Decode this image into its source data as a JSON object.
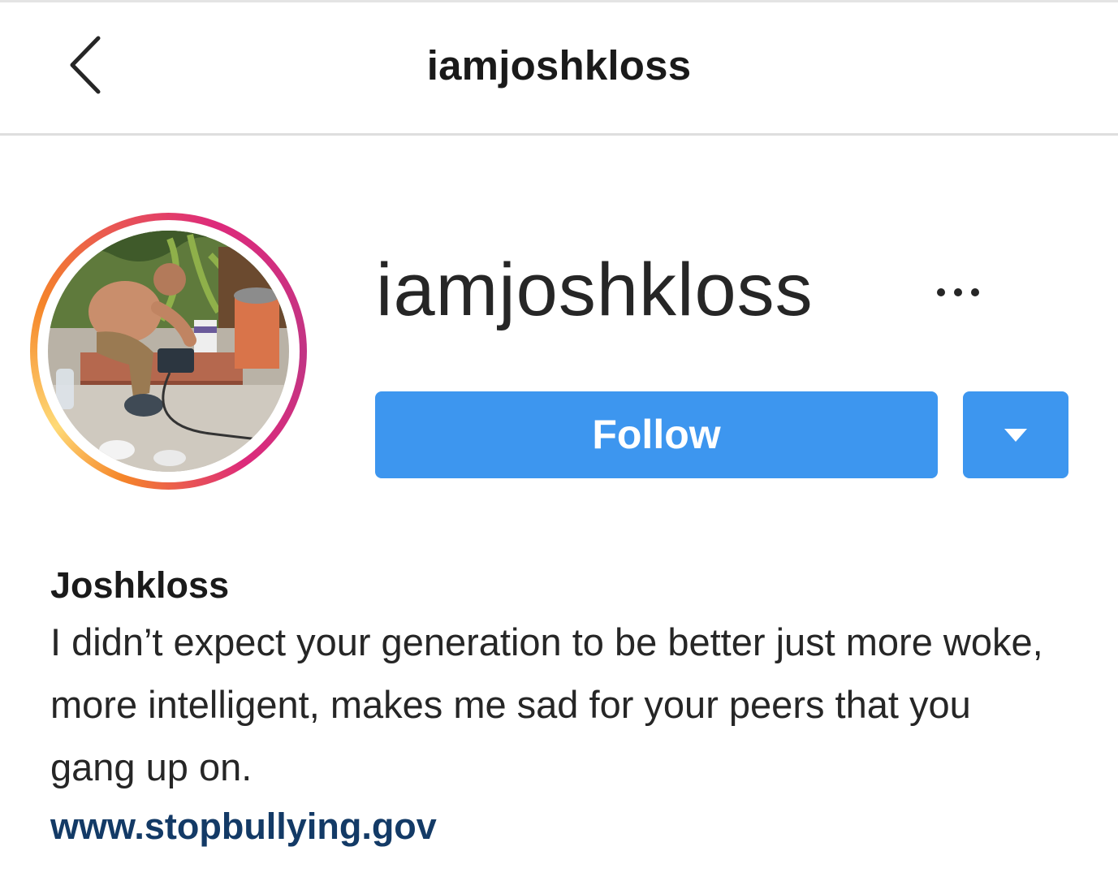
{
  "header": {
    "back_icon": "chevron-left-icon",
    "title": "iamjoshkloss"
  },
  "profile": {
    "avatar_description": "profile-photo",
    "story_ring_colors": [
      "#f58529",
      "#dd2a7b",
      "#c13584"
    ],
    "username": "iamjoshkloss",
    "more_icon": "ellipsis-icon",
    "follow_label": "Follow",
    "dropdown_icon": "caret-down-icon",
    "accent_color": "#3d96ef"
  },
  "bio": {
    "name": "Joshkloss",
    "text": "I didn’t expect your generation to be better just more woke, more intelligent, makes me sad for your peers that you gang up on.",
    "link": "www.stopbullying.gov",
    "link_color": "#133a66"
  }
}
